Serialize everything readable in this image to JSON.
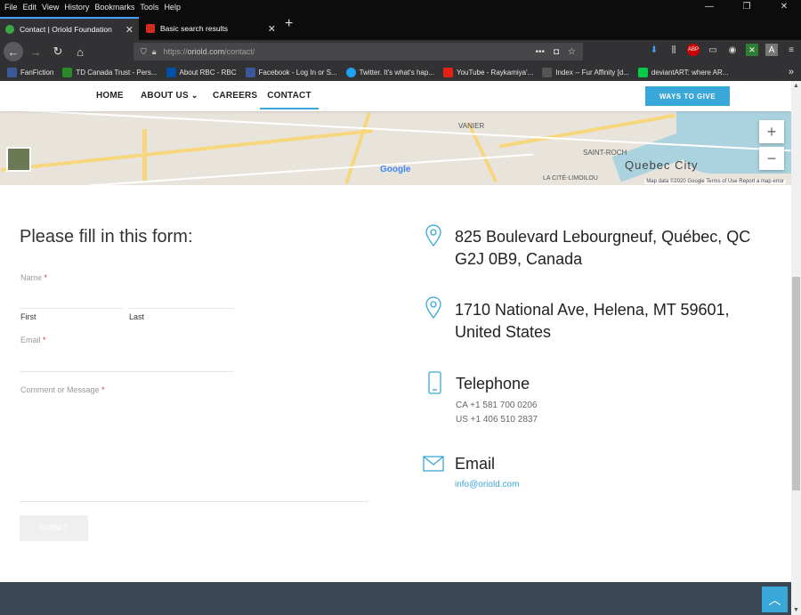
{
  "menubar": {
    "items": [
      "File",
      "Edit",
      "View",
      "History",
      "Bookmarks",
      "Tools",
      "Help"
    ]
  },
  "tabs": [
    {
      "label": "Contact | Oriold Foundation",
      "active": true,
      "icon": "oriold-favicon"
    },
    {
      "label": "Basic search results",
      "active": false,
      "icon": "maple-leaf-favicon"
    }
  ],
  "url": {
    "prefix": "https://",
    "host": "oriold.com",
    "path": "/contact/"
  },
  "bookmarks": [
    {
      "label": "FanFiction",
      "color": "#3b5998"
    },
    {
      "label": "TD Canada Trust - Pers...",
      "color": "#2a8a2a"
    },
    {
      "label": "About RBC - RBC",
      "color": "#0051a5"
    },
    {
      "label": "Facebook - Log In or S...",
      "color": "#3b5998"
    },
    {
      "label": "Twitter. It's what's hap...",
      "color": "#1da1f2"
    },
    {
      "label": "YouTube - Raykamiya'...",
      "color": "#e62117"
    },
    {
      "label": "Index -- Fur Affinity [d...",
      "color": "#555555"
    },
    {
      "label": "deviantART: where AR...",
      "color": "#05cc47"
    }
  ],
  "site_nav": {
    "items": [
      "HOME",
      "ABOUT US",
      "CAREERS",
      "CONTACT"
    ],
    "about_caret": "⌄",
    "cta": "WAYS TO GIVE"
  },
  "map": {
    "labels": {
      "vanier": "VANIER",
      "saint_roch": "SAINT-ROCH",
      "quebec_city": "Quebec City",
      "la_cite": "LA CITÉ-LIMOILOU",
      "google": "Google"
    },
    "attribution": "Map data ©2020 Google   Terms of Use   Report a map error",
    "zoom_in": "+",
    "zoom_out": "−"
  },
  "form": {
    "heading": "Please fill in this form:",
    "name_label": "Name",
    "first_label": "First",
    "last_label": "Last",
    "email_label": "Email",
    "message_label": "Comment or Message",
    "required_mark": "*",
    "submit_label": "SUBMIT"
  },
  "contact": {
    "address1": {
      "line1": "825 Boulevard Lebourgneuf, Québec, QC",
      "line2": "G2J 0B9, Canada"
    },
    "address2": {
      "line1": "1710 National Ave, Helena, MT 59601,",
      "line2": "United States"
    },
    "phone": {
      "title": "Telephone",
      "ca": "CA +1 581 700 0206",
      "us": "US +1 406 510 2837"
    },
    "email": {
      "title": "Email",
      "value": "info@oriold.com"
    }
  },
  "colors": {
    "accent": "#39a7d7",
    "footer": "#3b4755",
    "chrome_dark": "#0c0c0d"
  }
}
